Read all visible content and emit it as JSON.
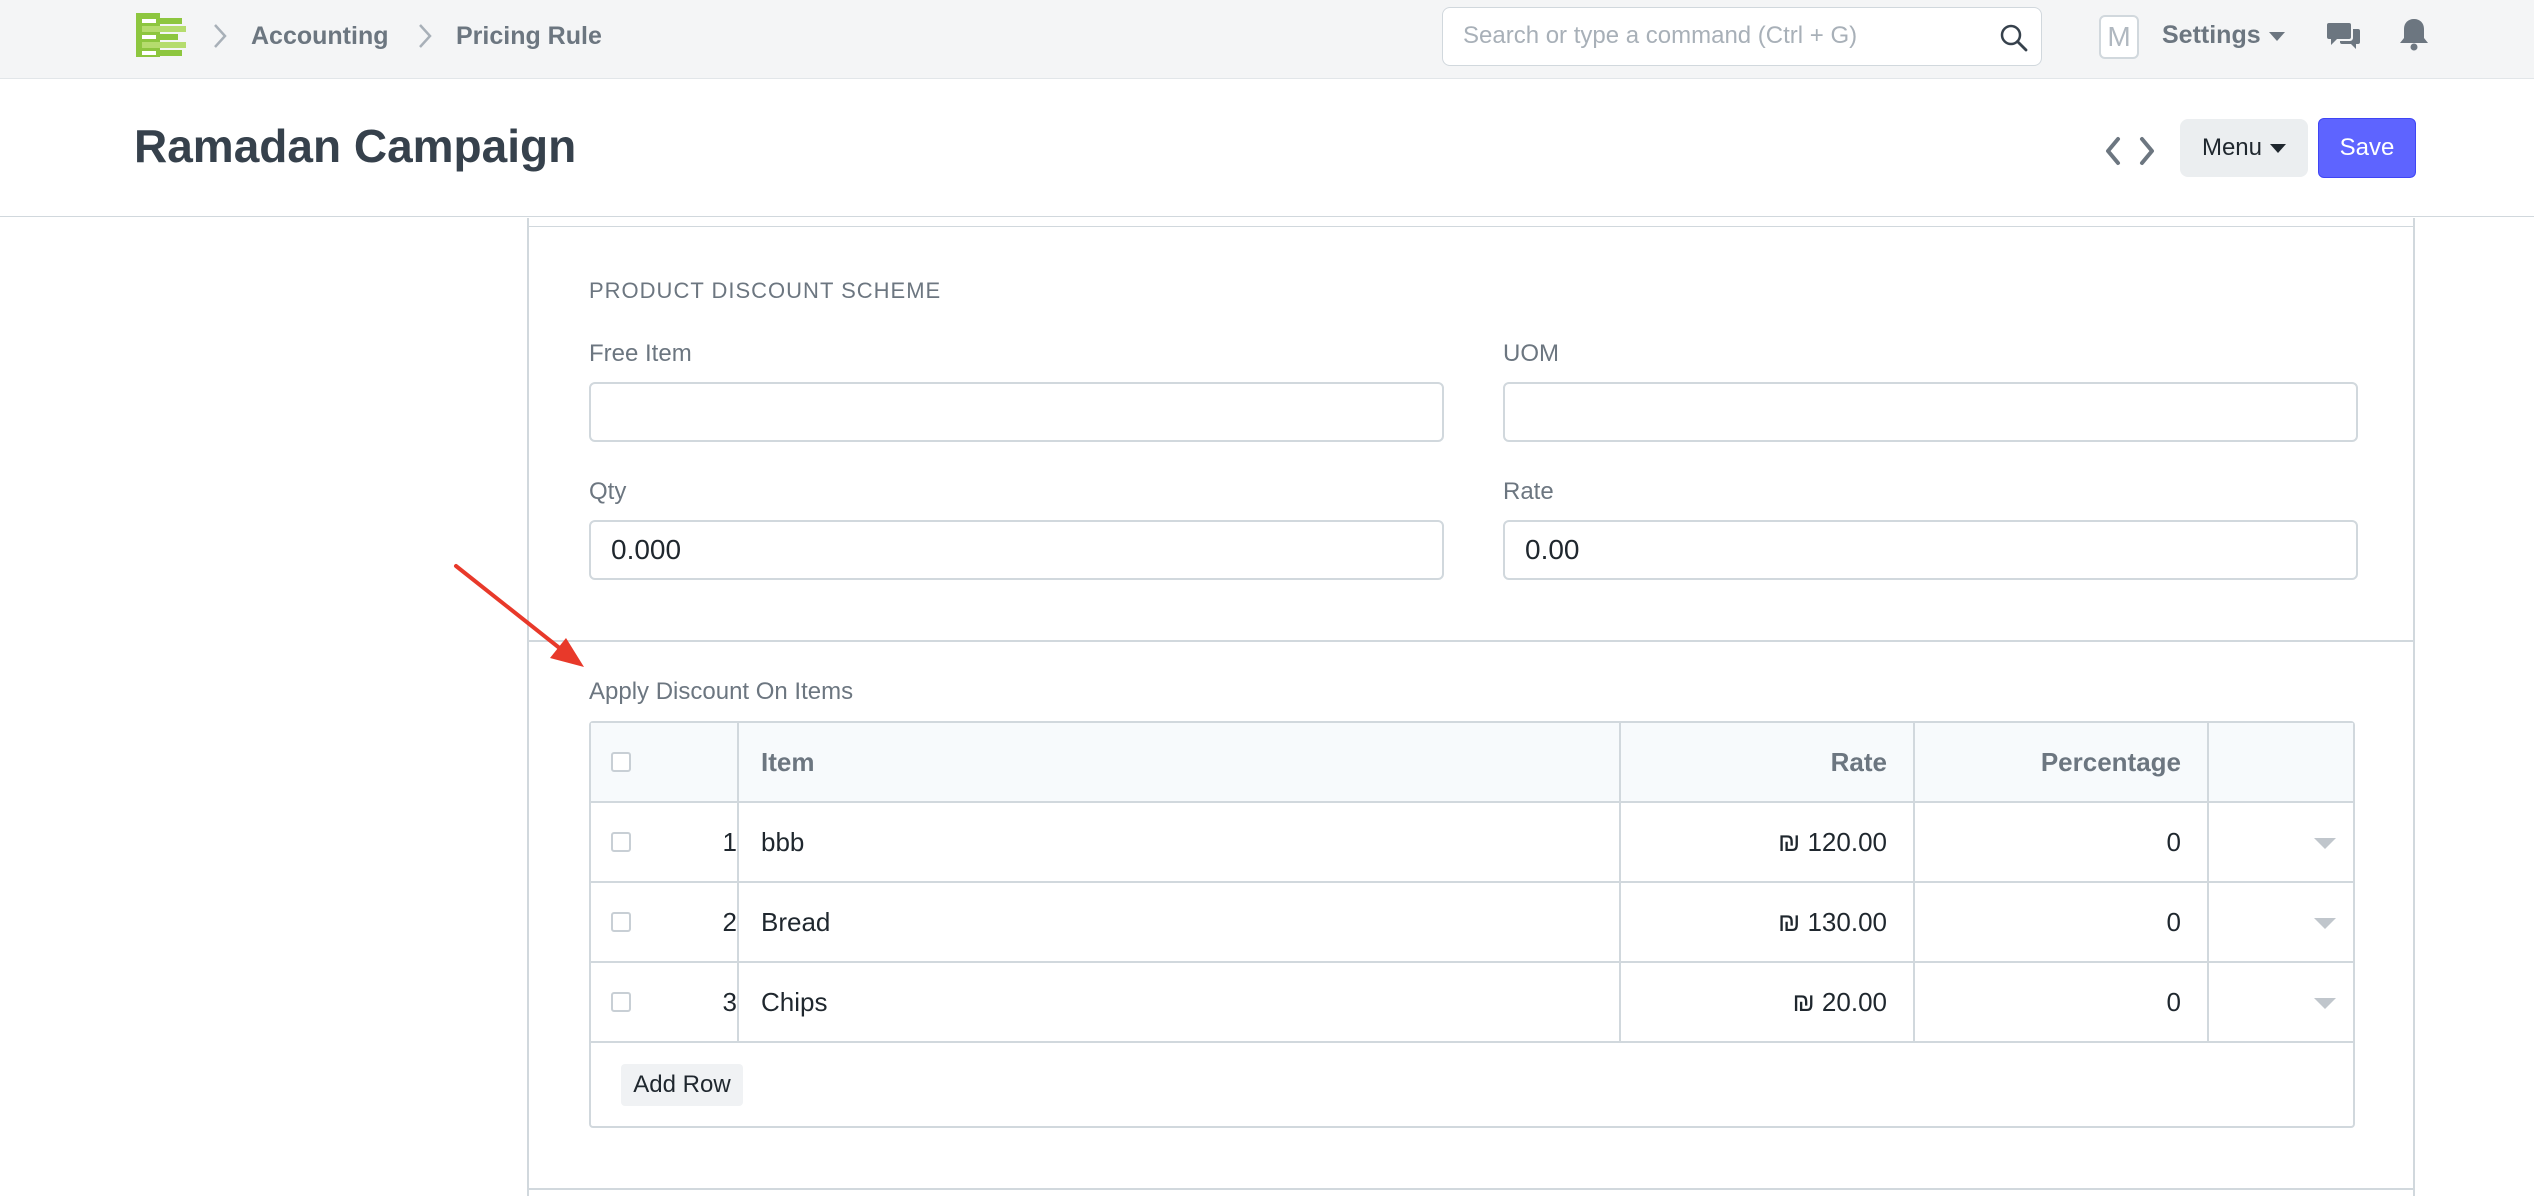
{
  "navbar": {
    "breadcrumbs": [
      "Accounting",
      "Pricing Rule"
    ],
    "search_placeholder": "Search or type a command (Ctrl + G)",
    "avatar_letter": "M",
    "settings_label": "Settings",
    "logo_color": "#8dc63f"
  },
  "page": {
    "title": "Ramadan Campaign",
    "menu_label": "Menu",
    "save_label": "Save",
    "save_color": "#5e64ff"
  },
  "product_discount": {
    "section_title": "PRODUCT DISCOUNT SCHEME",
    "free_item_label": "Free Item",
    "free_item_value": "",
    "uom_label": "UOM",
    "uom_value": "",
    "qty_label": "Qty",
    "qty_value": "0.000",
    "rate_label": "Rate",
    "rate_value": "0.00"
  },
  "items_table": {
    "label": "Apply Discount On Items",
    "columns": {
      "item": "Item",
      "rate": "Rate",
      "percentage": "Percentage"
    },
    "rows": [
      {
        "idx": "1",
        "item": "bbb",
        "rate": "₪ 120.00",
        "percentage": "0"
      },
      {
        "idx": "2",
        "item": "Bread",
        "rate": "₪ 130.00",
        "percentage": "0"
      },
      {
        "idx": "3",
        "item": "Chips",
        "rate": "₪ 20.00",
        "percentage": "0"
      }
    ],
    "add_row_label": "Add Row"
  },
  "annotation": {
    "arrow_color": "#e8392a"
  }
}
